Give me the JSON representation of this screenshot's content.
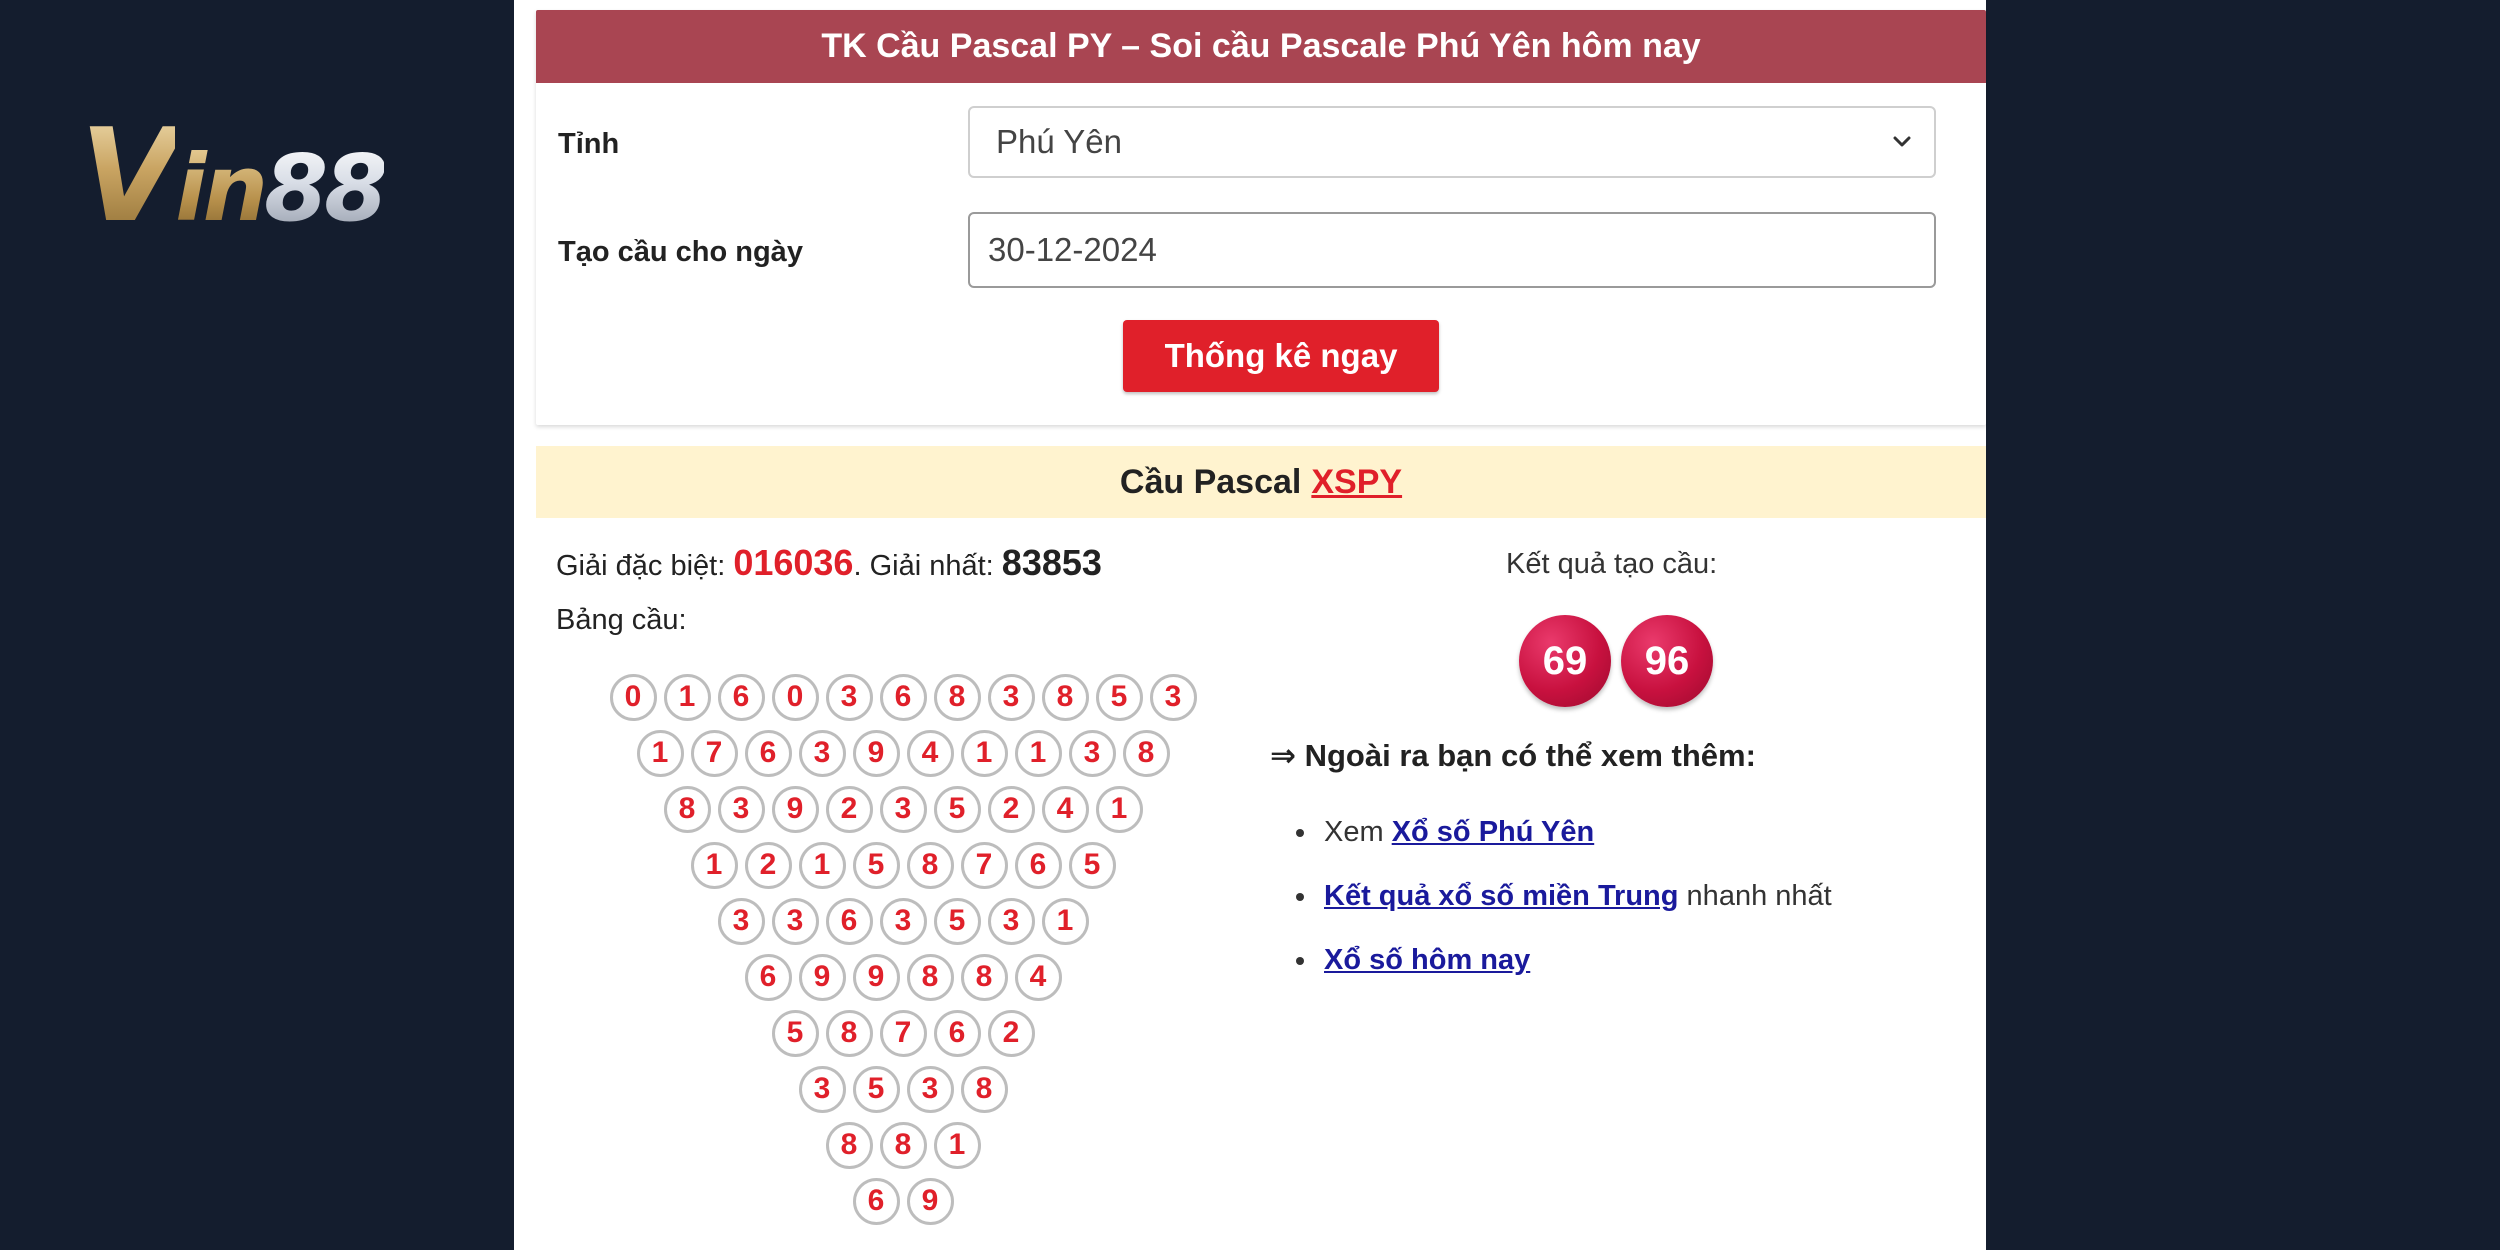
{
  "logo": {
    "v": "V",
    "in": "in",
    "n88": "88"
  },
  "form": {
    "title": "TK Cầu Pascal PY – Soi cầu Pascale Phú Yên hôm nay",
    "province_label": "Tỉnh",
    "province_value": "Phú Yên",
    "date_label": "Tạo cầu cho ngày",
    "date_value": "30-12-2024",
    "submit_label": "Thống kê ngay"
  },
  "result": {
    "title_prefix": "Cầu Pascal",
    "title_accent": "XSPY",
    "special_label": "Giải đặc biệt:",
    "special_value": "016036",
    "sep": ".",
    "first_label": "Giải nhất:",
    "first_value": "83853",
    "table_label": "Bảng cầu:",
    "rows": [
      [
        0,
        1,
        6,
        0,
        3,
        6,
        8,
        3,
        8,
        5,
        3
      ],
      [
        1,
        7,
        6,
        3,
        9,
        4,
        1,
        1,
        3,
        8
      ],
      [
        8,
        3,
        9,
        2,
        3,
        5,
        2,
        4,
        1
      ],
      [
        1,
        2,
        1,
        5,
        8,
        7,
        6,
        5
      ],
      [
        3,
        3,
        6,
        3,
        5,
        3,
        1
      ],
      [
        6,
        9,
        9,
        8,
        8,
        4
      ],
      [
        5,
        8,
        7,
        6,
        2
      ],
      [
        3,
        5,
        3,
        8
      ],
      [
        8,
        8,
        1
      ],
      [
        6,
        9
      ]
    ],
    "outcome_label": "Kết quả tạo cầu:",
    "outcome_values": [
      "69",
      "96"
    ]
  },
  "more": {
    "title": "⇒ Ngoài ra bạn có thể xem thêm:",
    "item1_prefix": "Xem ",
    "item1_link": "Xổ số Phú Yên",
    "item2_link": "Kết quả xổ số miền Trung",
    "item2_suffix": " nhanh nhất",
    "item3_link": "Xổ số hôm nay"
  },
  "colors": {
    "page_bg": "#141d2e",
    "header_bg": "#a94552",
    "accent_red": "#e0202a",
    "banner_bg": "#fff3cf",
    "link": "#1a1a9c"
  }
}
